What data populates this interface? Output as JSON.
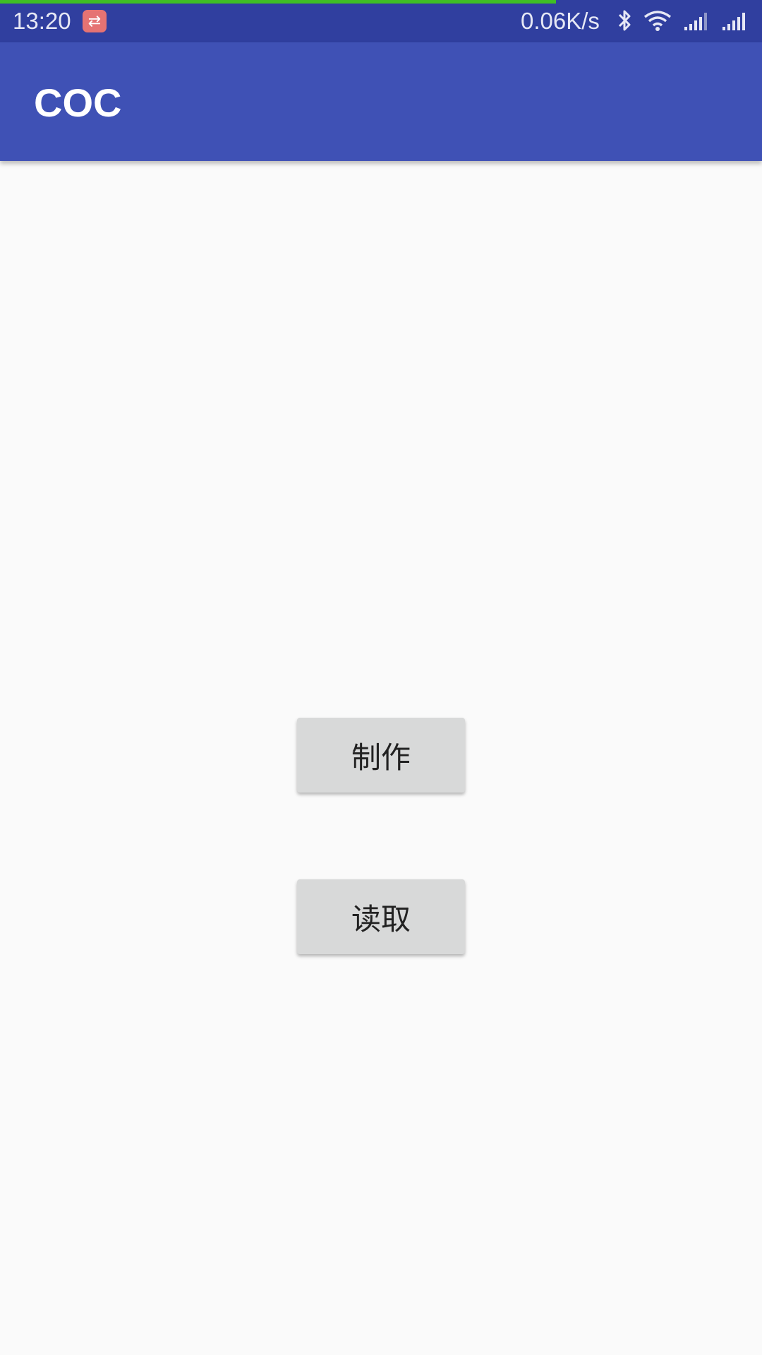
{
  "status_bar": {
    "time": "13:20",
    "notification_icon": "running-app-icon",
    "notification_glyph": "⇄",
    "network_speed": "0.06K/s",
    "icons": [
      "bluetooth-icon",
      "wifi-icon",
      "signal-icon",
      "signal-icon"
    ],
    "background": "#303f9f",
    "page_load_progress": 0.73
  },
  "app_bar": {
    "title": "COC",
    "background": "#3f51b5"
  },
  "main": {
    "buttons": [
      {
        "label": "制作"
      },
      {
        "label": "读取"
      }
    ],
    "background": "#fafafa"
  }
}
